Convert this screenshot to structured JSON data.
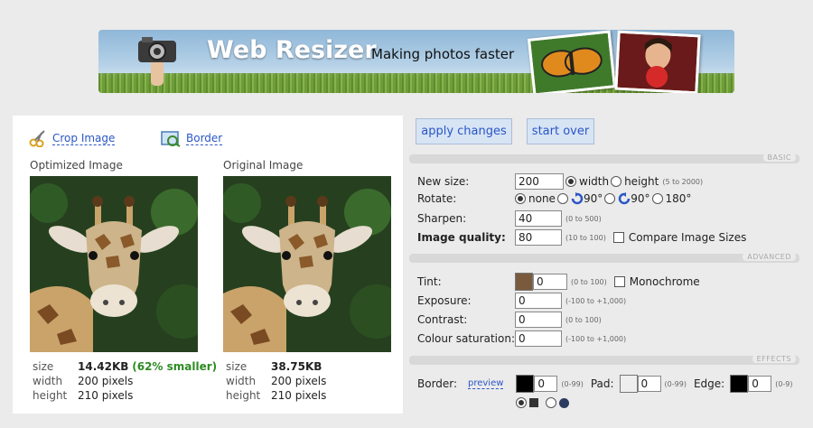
{
  "banner": {
    "title": "Web Resizer",
    "tagline": "Making photos faster"
  },
  "tools": {
    "crop_label": "Crop Image",
    "border_label": "Border"
  },
  "optimized": {
    "label": "Optimized Image",
    "size_key": "size",
    "size_val": "14.42KB",
    "savings": "(62% smaller)",
    "width_key": "width",
    "width_val": "200 pixels",
    "height_key": "height",
    "height_val": "210 pixels"
  },
  "original": {
    "label": "Original Image",
    "size_key": "size",
    "size_val": "38.75KB",
    "width_key": "width",
    "width_val": "200 pixels",
    "height_key": "height",
    "height_val": "210 pixels"
  },
  "actions": {
    "apply": "apply changes",
    "start_over": "start over"
  },
  "sections": {
    "basic": "BASIC",
    "advanced": "ADVANCED",
    "effects": "EFFECTS"
  },
  "basic": {
    "new_size_label": "New size:",
    "new_size_value": "200",
    "width_opt": "width",
    "height_opt": "height",
    "size_range": "(5 to 2000)",
    "rotate_label": "Rotate:",
    "rot_none": "none",
    "rot_cw": "90°",
    "rot_ccw": "90°",
    "rot_180": "180°",
    "sharpen_label": "Sharpen:",
    "sharpen_value": "40",
    "sharpen_range": "(0 to 500)",
    "quality_label": "Image quality:",
    "quality_value": "80",
    "quality_range": "(10 to 100)",
    "compare_label": "Compare Image Sizes"
  },
  "advanced": {
    "tint_label": "Tint:",
    "tint_value": "0",
    "tint_color": "#7a5a3c",
    "tint_range": "(0 to 100)",
    "mono_label": "Monochrome",
    "exposure_label": "Exposure:",
    "exposure_value": "0",
    "exposure_range": "(-100 to +1,000)",
    "contrast_label": "Contrast:",
    "contrast_value": "0",
    "contrast_range": "(0 to 100)",
    "saturation_label": "Colour saturation:",
    "saturation_value": "0",
    "saturation_range": "(-100 to +1,000)"
  },
  "effects": {
    "border_label": "Border:",
    "preview_label": "preview",
    "border_value": "0",
    "border_range": "(0-99)",
    "pad_label": "Pad:",
    "pad_value": "0",
    "pad_range": "(0-99)",
    "edge_label": "Edge:",
    "edge_value": "0",
    "edge_range": "(0-9)"
  }
}
